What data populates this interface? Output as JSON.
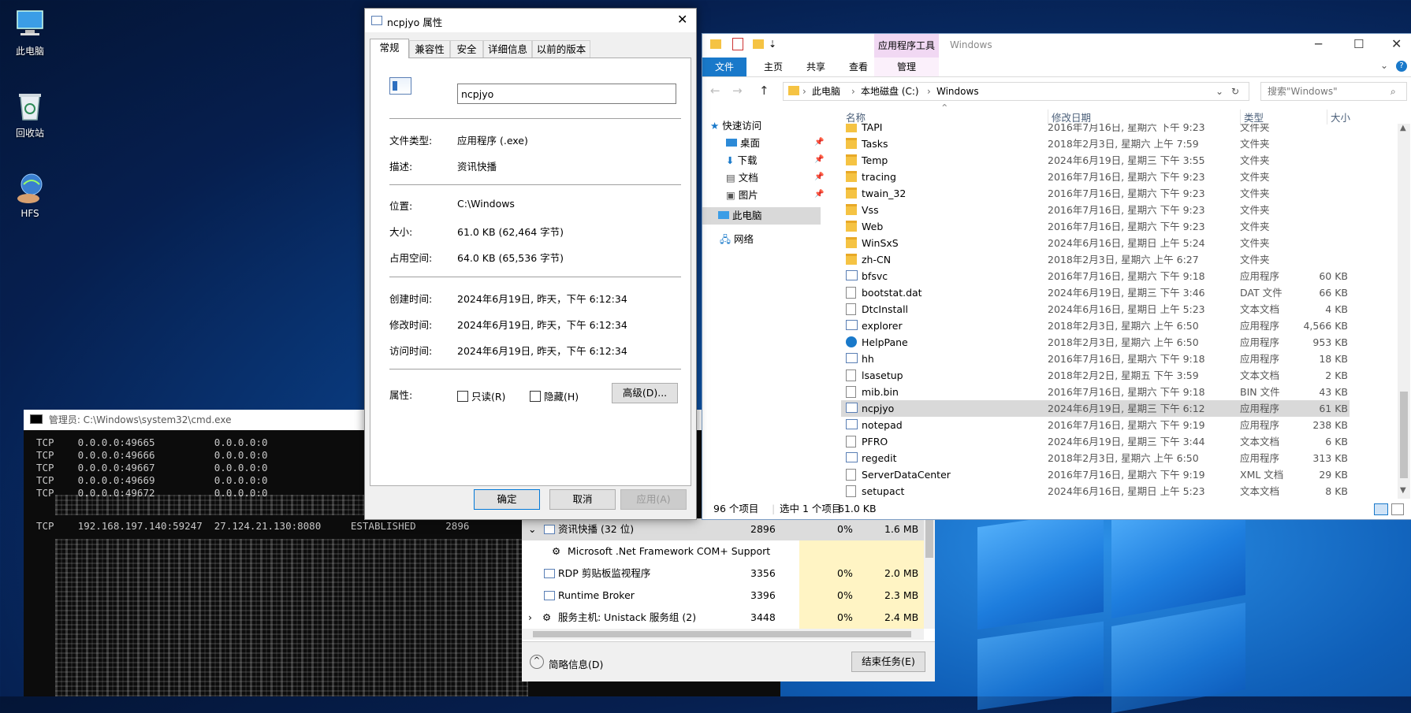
{
  "desktop": {
    "icons": [
      "此电脑",
      "回收站",
      "HFS"
    ]
  },
  "cmd": {
    "title": "管理员: C:\\Windows\\system32\\cmd.exe",
    "lines": [
      "TCP    0.0.0.0:49665          0.0.0.0:0",
      "TCP    0.0.0.0:49666          0.0.0.0:0",
      "TCP    0.0.0.0:49667          0.0.0.0:0",
      "TCP    0.0.0.0:49669          0.0.0.0:0",
      "TCP    0.0.0.0:49672          0.0.0.0:0"
    ],
    "highlight_line": "TCP    192.168.197.140:59247  27.124.21.130:8080     ESTABLISHED     2896"
  },
  "taskmgr": {
    "rows": [
      {
        "name": "资讯快播 (32 位)",
        "pid": "2896",
        "cpu": "0%",
        "mem": "1.6 MB"
      },
      {
        "name": "Microsoft .Net Framework COM+ Support",
        "pid": "",
        "cpu": "",
        "mem": ""
      },
      {
        "name": "RDP 剪贴板监视程序",
        "pid": "3356",
        "cpu": "0%",
        "mem": "2.0 MB"
      },
      {
        "name": "Runtime Broker",
        "pid": "3396",
        "cpu": "0%",
        "mem": "2.3 MB"
      },
      {
        "name": "服务主机: Unistack 服务组 (2)",
        "pid": "3448",
        "cpu": "0%",
        "mem": "2.4 MB"
      }
    ],
    "fewer_details": "简略信息(D)",
    "end_task": "结束任务(E)"
  },
  "props": {
    "title": "ncpjyo 属性",
    "tabs": [
      "常规",
      "兼容性",
      "安全",
      "详细信息",
      "以前的版本"
    ],
    "filename": "ncpjyo",
    "fields": [
      {
        "label": "文件类型:",
        "value": "应用程序 (.exe)"
      },
      {
        "label": "描述:",
        "value": "资讯快播"
      },
      {
        "label": "位置:",
        "value": "C:\\Windows"
      },
      {
        "label": "大小:",
        "value": "61.0 KB (62,464 字节)"
      },
      {
        "label": "占用空间:",
        "value": "64.0 KB (65,536 字节)"
      },
      {
        "label": "创建时间:",
        "value": "2024年6月19日, 昨天，下午 6:12:34"
      },
      {
        "label": "修改时间:",
        "value": "2024年6月19日, 昨天，下午 6:12:34"
      },
      {
        "label": "访问时间:",
        "value": "2024年6月19日, 昨天，下午 6:12:34"
      }
    ],
    "attributes_label": "属性:",
    "readonly": "只读(R)",
    "hidden": "隐藏(H)",
    "advanced": "高级(D)...",
    "ok": "确定",
    "cancel": "取消",
    "apply": "应用(A)"
  },
  "explorer": {
    "title": "Windows",
    "context_tab": "应用程序工具",
    "ribbon_tabs": [
      "文件",
      "主页",
      "共享",
      "查看",
      "管理"
    ],
    "breadcrumb": [
      "此电脑",
      "本地磁盘 (C:)",
      "Windows"
    ],
    "search_placeholder": "搜索\"Windows\"",
    "columns": [
      "名称",
      "修改日期",
      "类型",
      "大小"
    ],
    "nav": {
      "quick_access": "快速访问",
      "items": [
        "桌面",
        "下载",
        "文档",
        "图片"
      ],
      "this_pc": "此电脑",
      "network": "网络"
    },
    "files": [
      {
        "name": "TAPI",
        "date": "2016年7月16日, 星期六 下午 9:23",
        "type": "文件夹",
        "size": "",
        "icon": "folder"
      },
      {
        "name": "Tasks",
        "date": "2018年2月3日, 星期六 上午 7:59",
        "type": "文件夹",
        "size": "",
        "icon": "folder"
      },
      {
        "name": "Temp",
        "date": "2024年6月19日, 星期三 下午 3:55",
        "type": "文件夹",
        "size": "",
        "icon": "folder"
      },
      {
        "name": "tracing",
        "date": "2016年7月16日, 星期六 下午 9:23",
        "type": "文件夹",
        "size": "",
        "icon": "folder"
      },
      {
        "name": "twain_32",
        "date": "2016年7月16日, 星期六 下午 9:23",
        "type": "文件夹",
        "size": "",
        "icon": "folder"
      },
      {
        "name": "Vss",
        "date": "2016年7月16日, 星期六 下午 9:23",
        "type": "文件夹",
        "size": "",
        "icon": "folder"
      },
      {
        "name": "Web",
        "date": "2016年7月16日, 星期六 下午 9:23",
        "type": "文件夹",
        "size": "",
        "icon": "folder"
      },
      {
        "name": "WinSxS",
        "date": "2024年6月16日, 星期日 上午 5:24",
        "type": "文件夹",
        "size": "",
        "icon": "folder"
      },
      {
        "name": "zh-CN",
        "date": "2018年2月3日, 星期六 上午 6:27",
        "type": "文件夹",
        "size": "",
        "icon": "folder"
      },
      {
        "name": "bfsvc",
        "date": "2016年7月16日, 星期六 下午 9:18",
        "type": "应用程序",
        "size": "60 KB",
        "icon": "app"
      },
      {
        "name": "bootstat.dat",
        "date": "2024年6月19日, 星期三 下午 3:46",
        "type": "DAT 文件",
        "size": "66 KB",
        "icon": "doc"
      },
      {
        "name": "DtcInstall",
        "date": "2024年6月16日, 星期日 上午 5:23",
        "type": "文本文档",
        "size": "4 KB",
        "icon": "doc"
      },
      {
        "name": "explorer",
        "date": "2018年2月3日, 星期六 上午 6:50",
        "type": "应用程序",
        "size": "4,566 KB",
        "icon": "app"
      },
      {
        "name": "HelpPane",
        "date": "2018年2月3日, 星期六 上午 6:50",
        "type": "应用程序",
        "size": "953 KB",
        "icon": "help"
      },
      {
        "name": "hh",
        "date": "2016年7月16日, 星期六 下午 9:18",
        "type": "应用程序",
        "size": "18 KB",
        "icon": "app"
      },
      {
        "name": "lsasetup",
        "date": "2018年2月2日, 星期五 下午 3:59",
        "type": "文本文档",
        "size": "2 KB",
        "icon": "doc"
      },
      {
        "name": "mib.bin",
        "date": "2016年7月16日, 星期六 下午 9:18",
        "type": "BIN 文件",
        "size": "43 KB",
        "icon": "doc"
      },
      {
        "name": "ncpjyo",
        "date": "2024年6月19日, 星期三 下午 6:12",
        "type": "应用程序",
        "size": "61 KB",
        "icon": "app",
        "selected": true
      },
      {
        "name": "notepad",
        "date": "2016年7月16日, 星期六 下午 9:19",
        "type": "应用程序",
        "size": "238 KB",
        "icon": "app"
      },
      {
        "name": "PFRO",
        "date": "2024年6月19日, 星期三 下午 3:44",
        "type": "文本文档",
        "size": "6 KB",
        "icon": "doc"
      },
      {
        "name": "regedit",
        "date": "2018年2月3日, 星期六 上午 6:50",
        "type": "应用程序",
        "size": "313 KB",
        "icon": "app"
      },
      {
        "name": "ServerDataCenter",
        "date": "2016年7月16日, 星期六 下午 9:19",
        "type": "XML 文档",
        "size": "29 KB",
        "icon": "doc"
      },
      {
        "name": "setupact",
        "date": "2024年6月16日, 星期日 上午 5:23",
        "type": "文本文档",
        "size": "8 KB",
        "icon": "doc"
      }
    ],
    "status": {
      "count": "96 个项目",
      "selected": "选中 1 个项目",
      "size": "61.0 KB"
    }
  }
}
